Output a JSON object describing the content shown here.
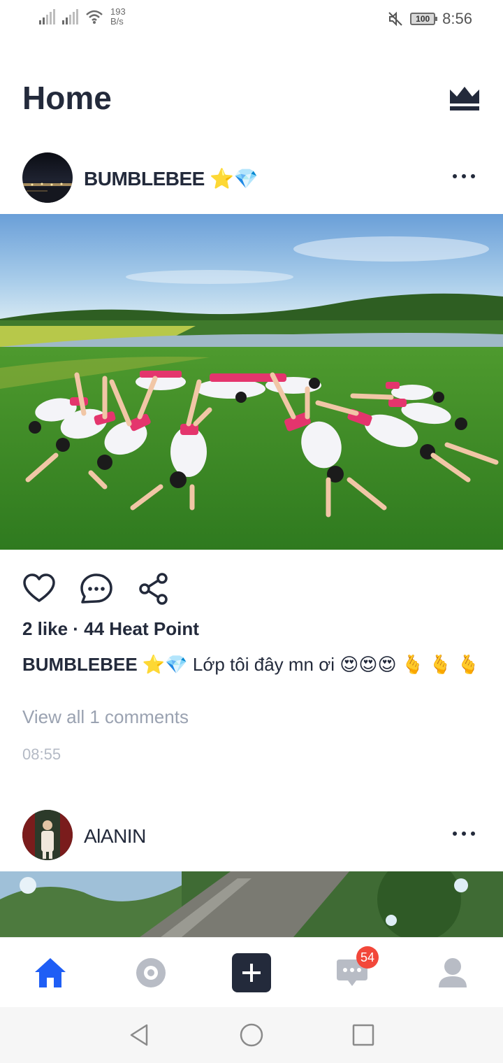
{
  "status_bar": {
    "net_speed_value": "193",
    "net_speed_unit": "B/s",
    "battery": "100",
    "time": "8:56"
  },
  "header": {
    "title": "Home",
    "premium_icon": "crown-icon"
  },
  "posts": [
    {
      "username": "BUMBLEBEE ⭐💎",
      "likes_text": "2 like · 44 Heat Point",
      "caption_user": "BUMBLEBEE ⭐💎",
      "caption_text": "Lớp tôi đây mn ơi 😍😍😍 🫰 🫰 🫰",
      "view_comments": "View all 1 comments",
      "time": "08:55"
    },
    {
      "username": "AlANIN"
    }
  ],
  "actions": {
    "like_icon": "heart-icon",
    "comment_icon": "comment-icon",
    "share_icon": "share-icon"
  },
  "bottom_nav": {
    "items": [
      "home-icon",
      "eye-icon",
      "plus-icon",
      "messages-icon",
      "profile-icon"
    ],
    "messages_badge": "54",
    "active_color": "#1f5ef5"
  }
}
